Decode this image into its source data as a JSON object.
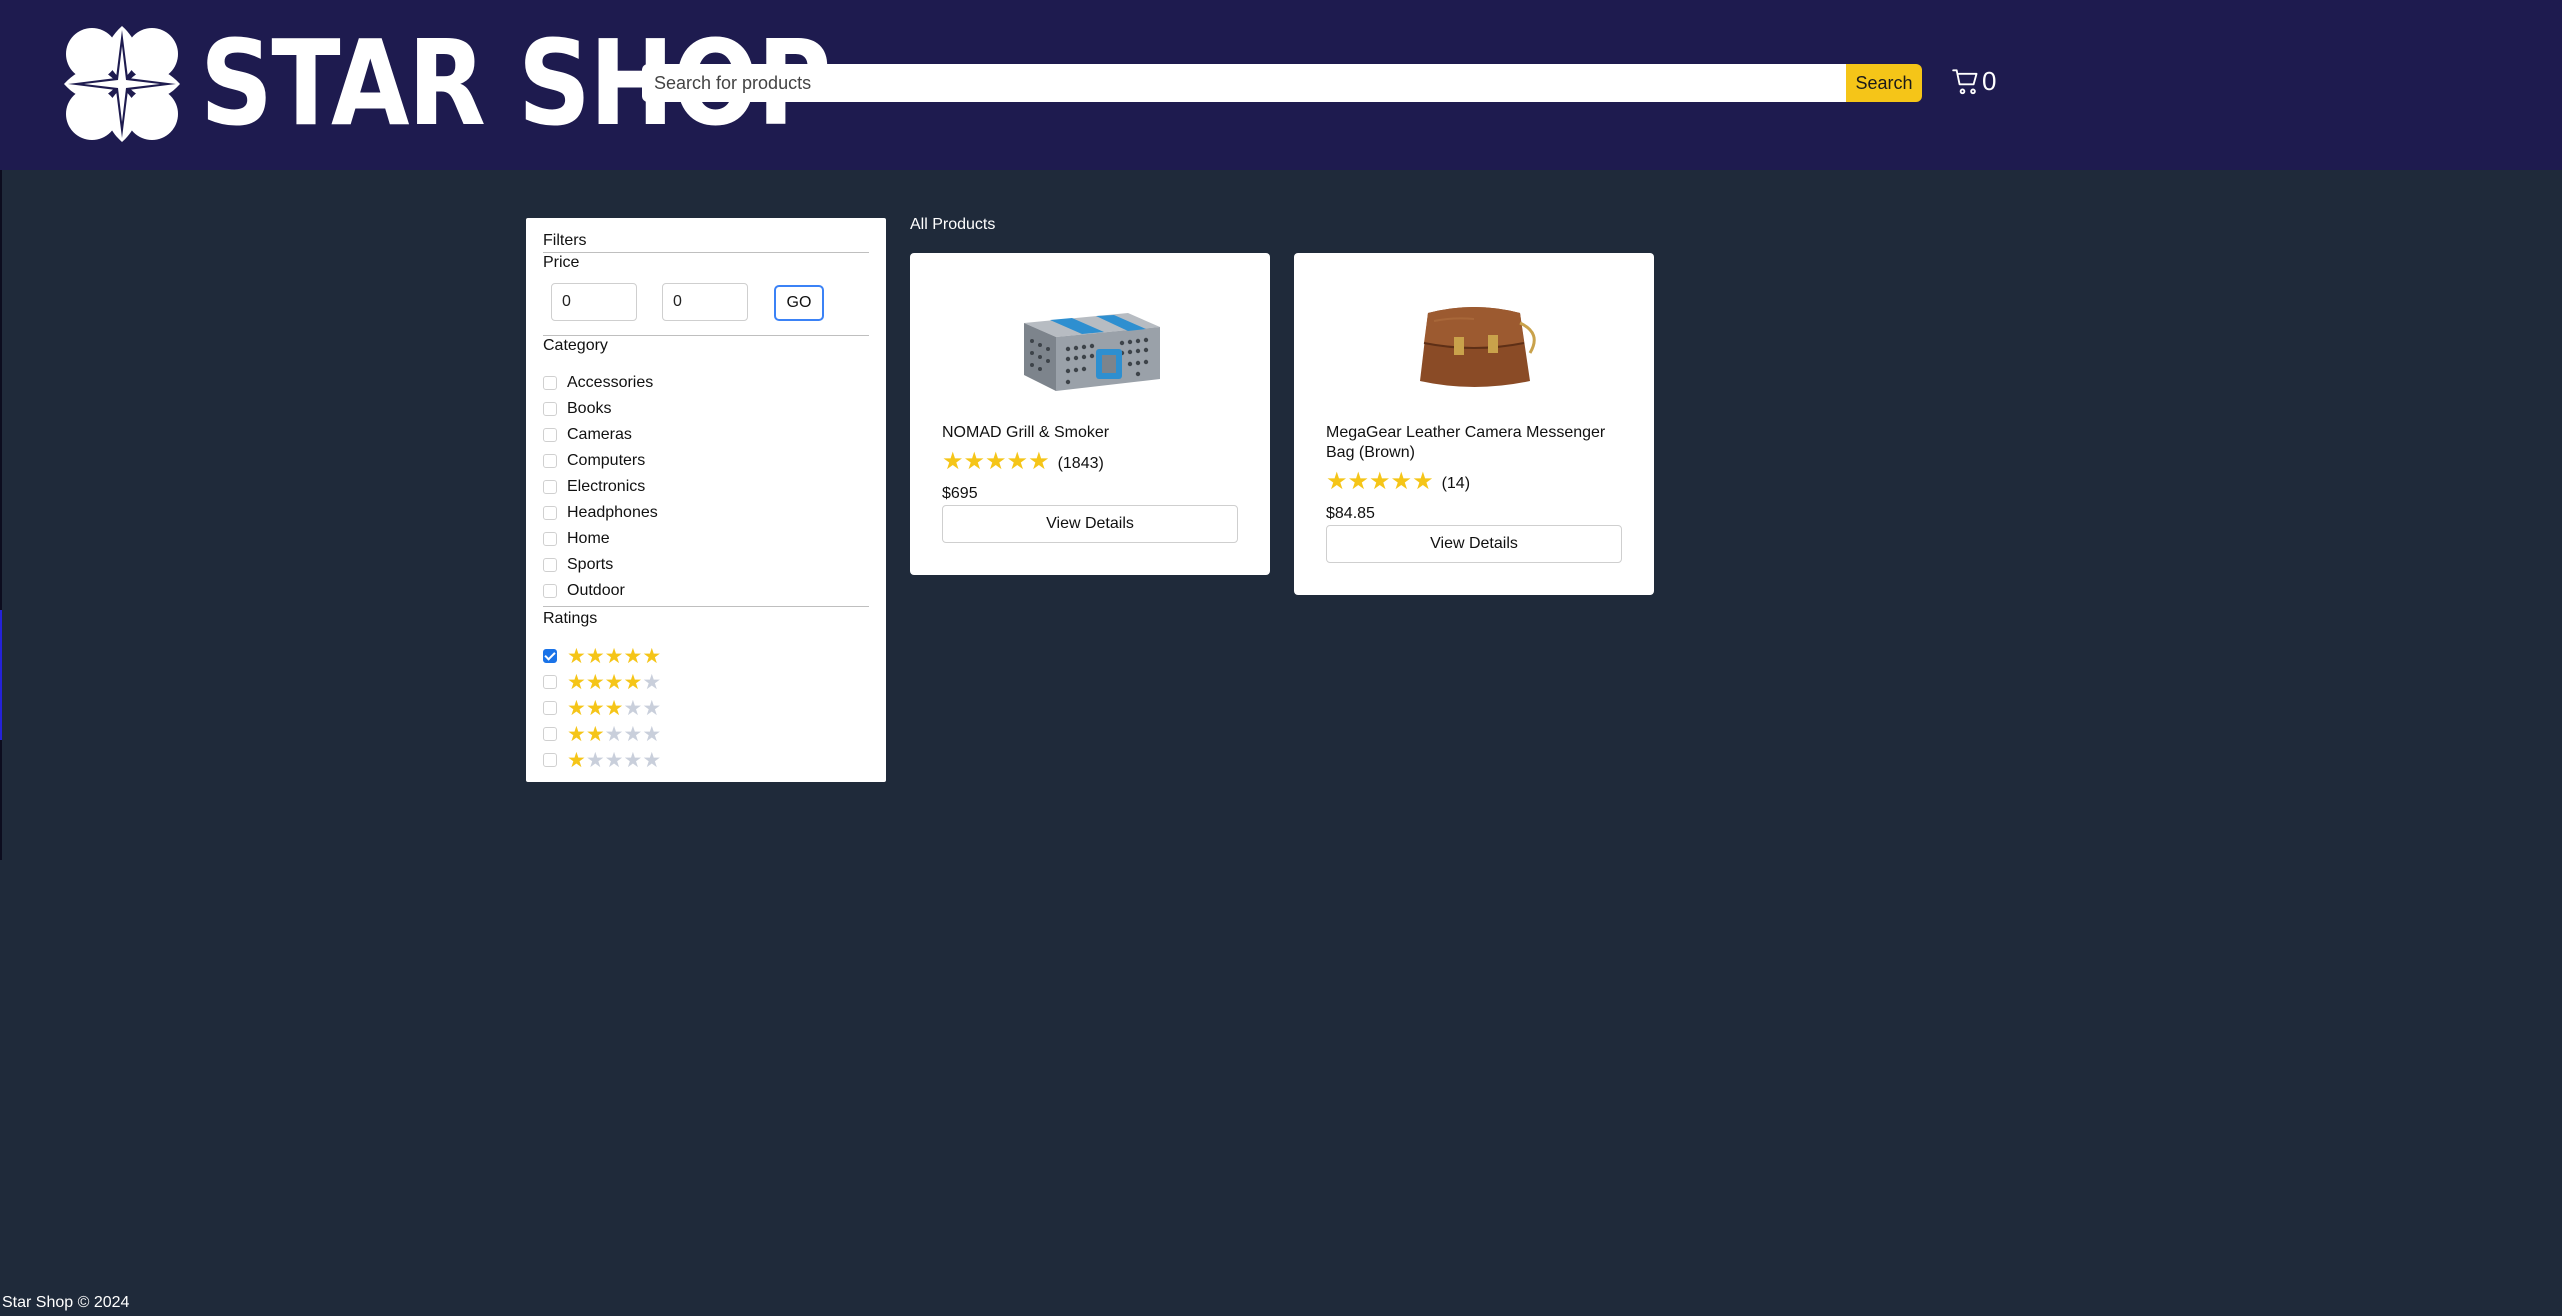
{
  "brand": {
    "name": "STAR SHOP"
  },
  "search": {
    "placeholder": "Search for products",
    "button_label": "Search"
  },
  "cart": {
    "count": "0",
    "icon": "cart-icon"
  },
  "filters": {
    "title": "Filters",
    "price": {
      "label": "Price",
      "min_value": "0",
      "max_value": "0",
      "go_label": "GO"
    },
    "category": {
      "label": "Category",
      "items": [
        {
          "label": "Accessories",
          "checked": false
        },
        {
          "label": "Books",
          "checked": false
        },
        {
          "label": "Cameras",
          "checked": false
        },
        {
          "label": "Computers",
          "checked": false
        },
        {
          "label": "Electronics",
          "checked": false
        },
        {
          "label": "Headphones",
          "checked": false
        },
        {
          "label": "Home",
          "checked": false
        },
        {
          "label": "Sports",
          "checked": false
        },
        {
          "label": "Outdoor",
          "checked": false
        }
      ]
    },
    "ratings": {
      "label": "Ratings",
      "items": [
        {
          "stars": 5,
          "checked": true
        },
        {
          "stars": 4,
          "checked": false
        },
        {
          "stars": 3,
          "checked": false
        },
        {
          "stars": 2,
          "checked": false
        },
        {
          "stars": 1,
          "checked": false
        }
      ]
    }
  },
  "products": {
    "title": "All Products",
    "items": [
      {
        "name": "NOMAD Grill & Smoker",
        "rating": 5,
        "reviews": "(1843)",
        "price": "$695",
        "button_label": "View Details",
        "image": "grill-case"
      },
      {
        "name": "MegaGear Leather Camera Messenger Bag (Brown)",
        "rating": 5,
        "reviews": "(14)",
        "price": "$84.85",
        "button_label": "View Details",
        "image": "leather-bag"
      }
    ]
  },
  "colors": {
    "header_bg": "#1e1b4f",
    "page_bg": "#1f2a3a",
    "accent": "#f5c518",
    "star": "#f5c518"
  },
  "footer": {
    "text": "Star Shop © 2024"
  }
}
